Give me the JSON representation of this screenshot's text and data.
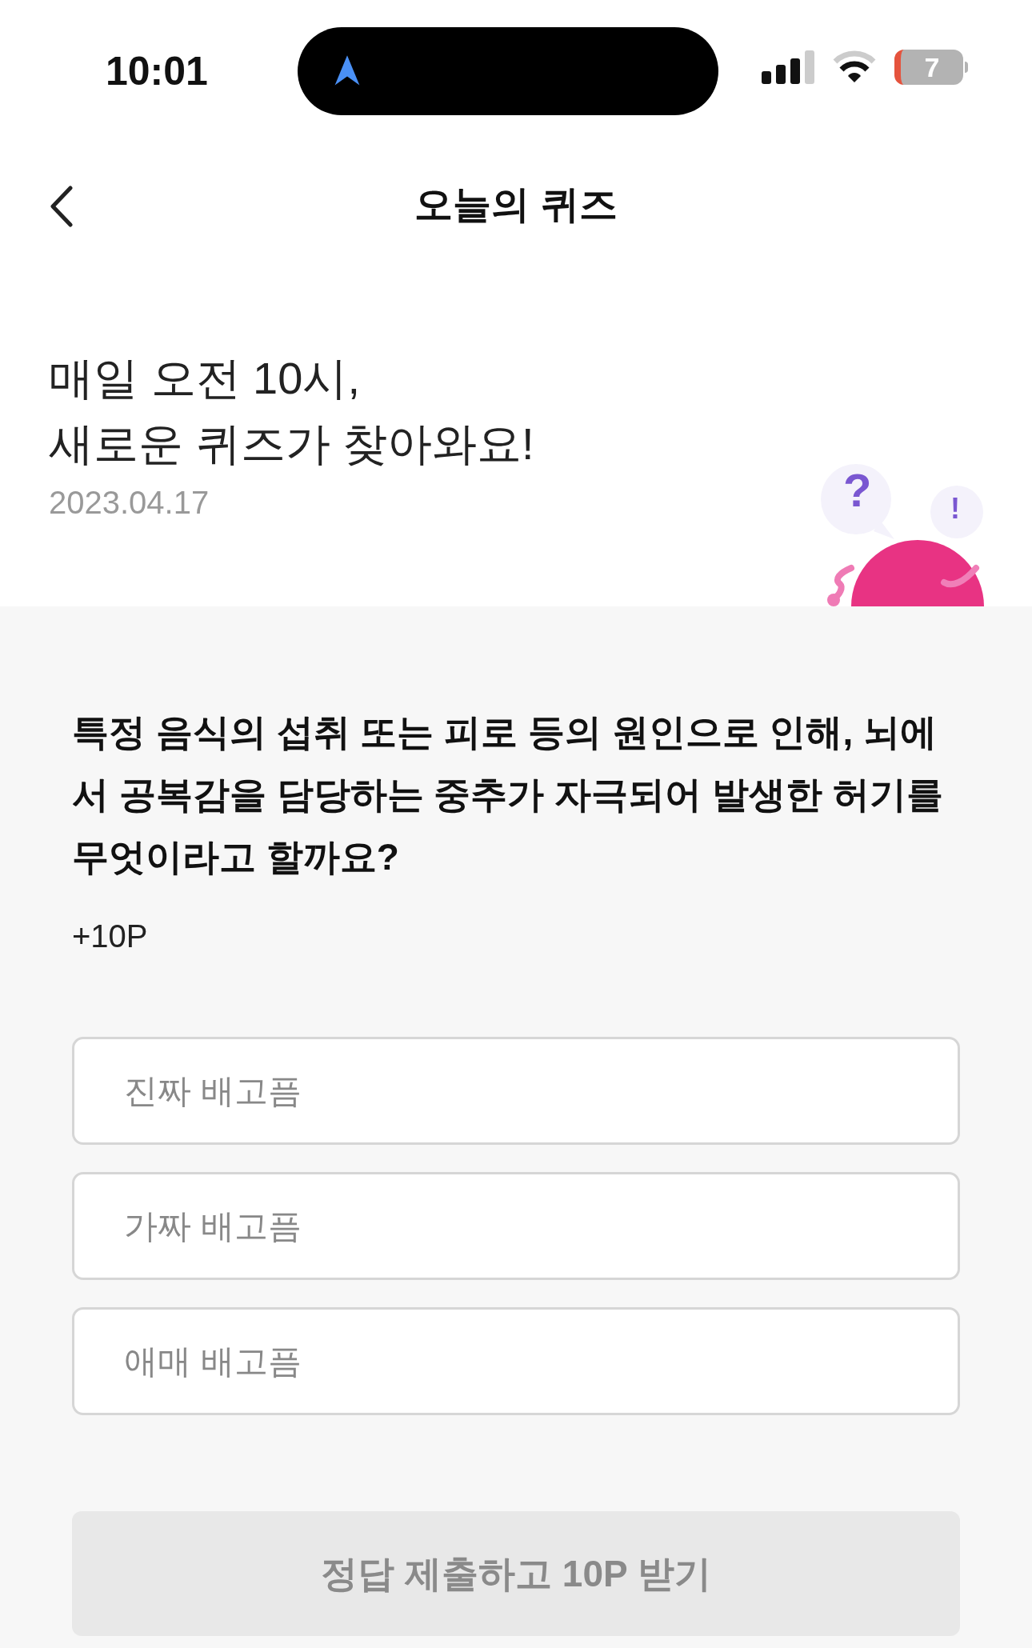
{
  "status_bar": {
    "time": "10:01",
    "battery": "7"
  },
  "header": {
    "title": "오늘의 퀴즈"
  },
  "intro": {
    "lines": [
      "매일 오전 10시,",
      "새로운 퀴즈가 찾아와요!"
    ],
    "date": "2023.04.17"
  },
  "illustration": {
    "bubbles": [
      "?",
      "!"
    ]
  },
  "quiz": {
    "question": "특정 음식의 섭취 또는 피로 등의 원인으로 인해, 뇌에서 공복감을 담당하는 중추가 자극되어 발생한 허기를 무엇이라고 할까요?",
    "points": "+10P",
    "options": [
      {
        "label": "진짜 배고픔",
        "selected": false
      },
      {
        "label": "가짜 배고픔",
        "selected": false
      },
      {
        "label": "애매 배고픔",
        "selected": false
      }
    ]
  },
  "submit": {
    "label": "정답 제출하고 10P 받기",
    "disabled": true
  }
}
